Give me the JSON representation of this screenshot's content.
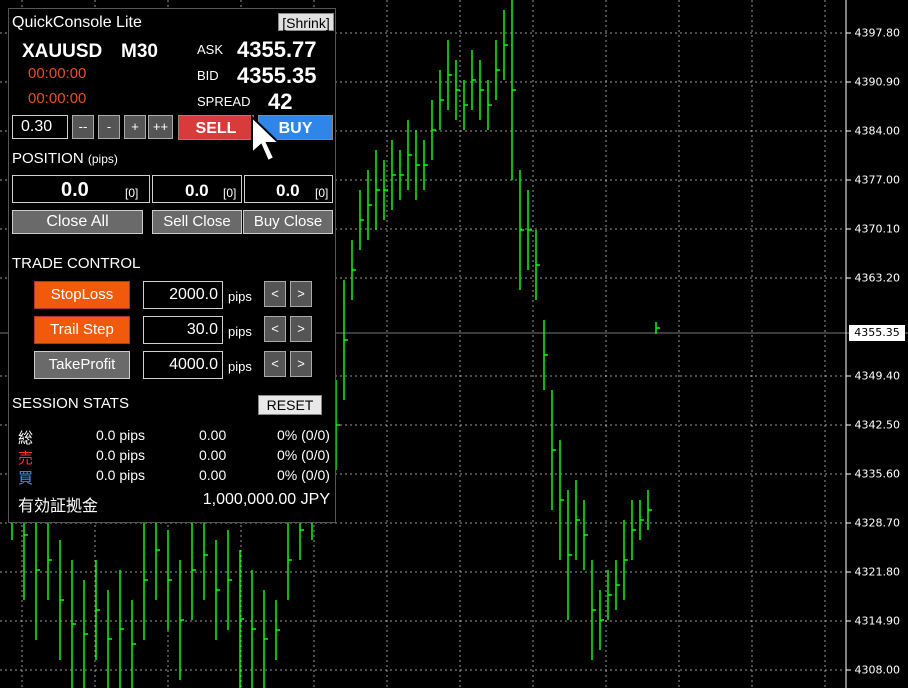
{
  "price_axis": {
    "labels": [
      "4397.80",
      "4390.90",
      "4384.00",
      "4377.00",
      "4370.10",
      "4363.20",
      "4349.40",
      "4342.50",
      "4335.60",
      "4328.70",
      "4321.80",
      "4314.90",
      "4308.00"
    ],
    "current_price": "4355.35",
    "line_color": "#00ff00",
    "grid_color": "#ffffff"
  },
  "panel": {
    "title": "QuickConsole Lite",
    "shrink_label": "[Shrink]",
    "symbol": "XAUUSD",
    "timeframe": "M30",
    "timer1": "00:00:00",
    "timer2": "00:00:00",
    "ask_label": "ASK",
    "ask_value": "4355.77",
    "bid_label": "BID",
    "bid_value": "4355.35",
    "spread_label": "SPREAD",
    "spread_value": "42",
    "lot_value": "0.30",
    "lot_buttons": [
      "--",
      "-",
      "+",
      "++"
    ],
    "sell_label": "SELL",
    "buy_label": "BUY",
    "position_label": "POSITION",
    "position_unit": "(pips)",
    "position_total": "0.0",
    "position_total_count": "[0]",
    "position_sell": "0.0",
    "position_sell_count": "[0]",
    "position_buy": "0.0",
    "position_buy_count": "[0]",
    "close_all": "Close All",
    "sell_close": "Sell Close",
    "buy_close": "Buy Close",
    "trade_control_label": "TRADE CONTROL",
    "controls": [
      {
        "label": "StopLoss",
        "value": "2000.0",
        "unit": "pips"
      },
      {
        "label": "Trail Step",
        "value": "30.0",
        "unit": "pips"
      },
      {
        "label": "TakeProfit",
        "value": "4000.0",
        "unit": "pips"
      }
    ],
    "arrow_left": "<",
    "arrow_right": ">",
    "session_stats_label": "SESSION STATS",
    "reset_label": "RESET",
    "stats": [
      {
        "label": "総",
        "pips": "0.0 pips",
        "amount": "0.00",
        "rate": "0% (0/0)",
        "color": "#ffffff"
      },
      {
        "label": "売",
        "pips": "0.0 pips",
        "amount": "0.00",
        "rate": "0% (0/0)",
        "color": "#ff3030"
      },
      {
        "label": "買",
        "pips": "0.0 pips",
        "amount": "0.00",
        "rate": "0% (0/0)",
        "color": "#3399ff"
      }
    ],
    "margin_label": "有効証拠金",
    "margin_value": "1,000,000.00 JPY"
  }
}
